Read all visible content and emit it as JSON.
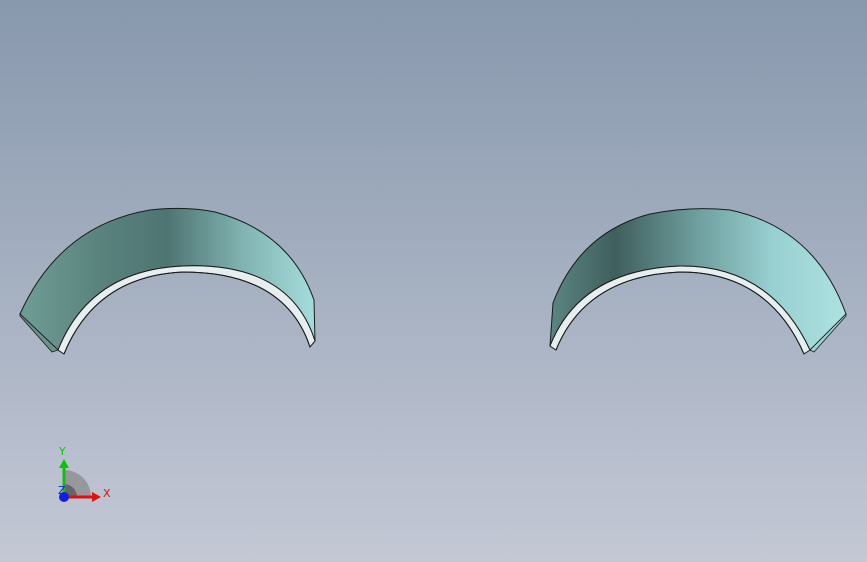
{
  "viewport": {
    "background_top": "#8898ad",
    "background_bottom": "#c4c8d5"
  },
  "parts": [
    {
      "name": "bearing-shell-left",
      "color_light": "#a6dcdc",
      "color_dark": "#4f7573"
    },
    {
      "name": "bearing-shell-right",
      "color_light": "#a6dcdc",
      "color_dark": "#4f7573"
    }
  ],
  "triad": {
    "x_label": "X",
    "y_label": "Y",
    "z_label": "Z",
    "x_color": "#e01010",
    "y_color": "#10c010",
    "z_color": "#1020e0"
  }
}
